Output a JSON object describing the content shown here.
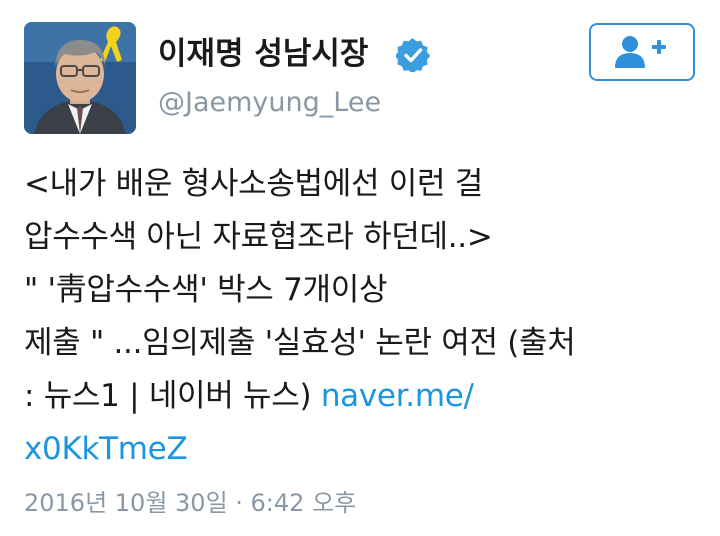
{
  "author": {
    "display_name": "이재명 성남시장",
    "handle": "@Jaemyung_Lee",
    "verified": true
  },
  "follow_button": {
    "icon": "add-user-icon",
    "accent_color": "#2f8fdc"
  },
  "tweet": {
    "lines": [
      "<내가 배운 형사소송법에선 이런 걸",
      "압수수색 아닌 자료협조라 하던데..>",
      " \" '靑압수수색' 박스 7개이상",
      "제출 \" ...임의제출 '실효성' 논란 여전 (출처",
      ": 뉴스1 | 네이버 뉴스) "
    ],
    "link_part1": "naver.me/",
    "link_part2": "x0KkTmeZ",
    "link_color": "#1b95e0"
  },
  "timestamp": "2016년 10월 30일 · 6:42 오후"
}
